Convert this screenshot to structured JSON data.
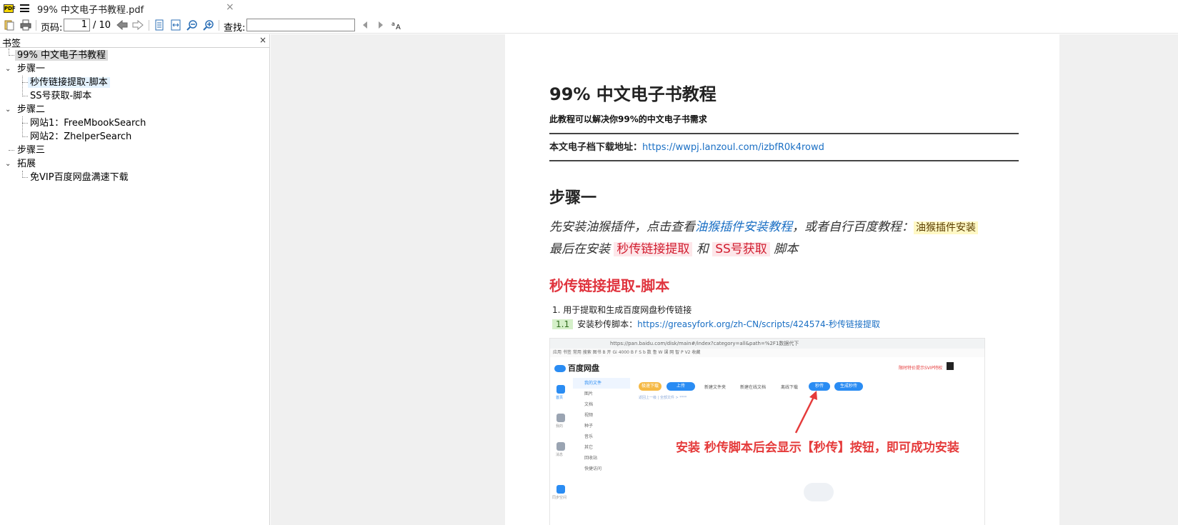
{
  "tab": {
    "title": "99% 中文电子书教程.pdf",
    "close": "×",
    "logo": "PDF"
  },
  "toolbar": {
    "page_label": "页码:",
    "page_value": "1",
    "page_total": "/ 10",
    "find_label": "查找:",
    "find_value": ""
  },
  "sidebar": {
    "title": "书签",
    "close": "×",
    "items": [
      {
        "label": "99% 中文电子书教程"
      },
      {
        "label": "步骤一"
      },
      {
        "label": "秒传链接提取-脚本"
      },
      {
        "label": "SS号获取-脚本"
      },
      {
        "label": "步骤二"
      },
      {
        "label": "网站1：FreeMbookSearch"
      },
      {
        "label": "网站2：ZhelperSearch"
      },
      {
        "label": "步骤三"
      },
      {
        "label": "拓展"
      },
      {
        "label": "免VIP百度网盘满速下载"
      }
    ]
  },
  "doc": {
    "title": "99% 中文电子书教程",
    "subtitle": "此教程可以解决你99%的中文电子书需求",
    "download_label": "本文电子档下载地址：",
    "download_url": "https://wwpj.lanzoul.com/izbfR0k4rowd",
    "step1": "步骤一",
    "step1_line1_a": "先安装油猴插件，点击查看",
    "step1_line1_link": "油猴插件安装教程",
    "step1_line1_b": "，或者自行百度教程：",
    "step1_line1_tag": "油猴插件安装",
    "step1_line2_a": "最后在安装",
    "step1_line2_tag1": "秒传链接提取",
    "step1_line2_b": "和",
    "step1_line2_tag2": "SS号获取",
    "step1_line2_c": "脚本",
    "section1": "秒传链接提取-脚本",
    "li1": "1.  用于提取和生成百度网盘秒传链接",
    "li2_tag": "1.1",
    "li2_label": "安装秒传脚本：",
    "li2_url": "https://greasyfork.org/zh-CN/scripts/424574-秒传链接提取"
  },
  "screenshot": {
    "url": "https://pan.baidu.com/disk/main#/index?category=all&path=%2F1数据代下",
    "bookmarks": "应用  书签  常用  搜索  图书  B  开  Gi  4000  B  F  S  b  数  鲁  W  课  网  智  P  V2  收藏",
    "brand": "百度网盘",
    "vip": "限时特价提示SVIP特权",
    "tree": [
      "我的文件",
      "图片",
      "文档",
      "视频",
      "种子",
      "音乐",
      "其它",
      "回收站",
      "快捷访问"
    ],
    "nav": [
      "首页",
      "我的",
      "消息",
      "同步空间"
    ],
    "btn_download": "极速下载",
    "btn_upload": "上传",
    "txt_newfolder": "新建文件夹",
    "txt_newonline": "新建在线文档",
    "txt_offline": "离线下载",
    "btn_miaochuan": "秒传",
    "btn_generate": "生成秒传",
    "crumb": "返回上一级  |  全部文件  >  ****",
    "note": "安装 秒传脚本后会显示【秒传】按钮，即可成功安装"
  }
}
